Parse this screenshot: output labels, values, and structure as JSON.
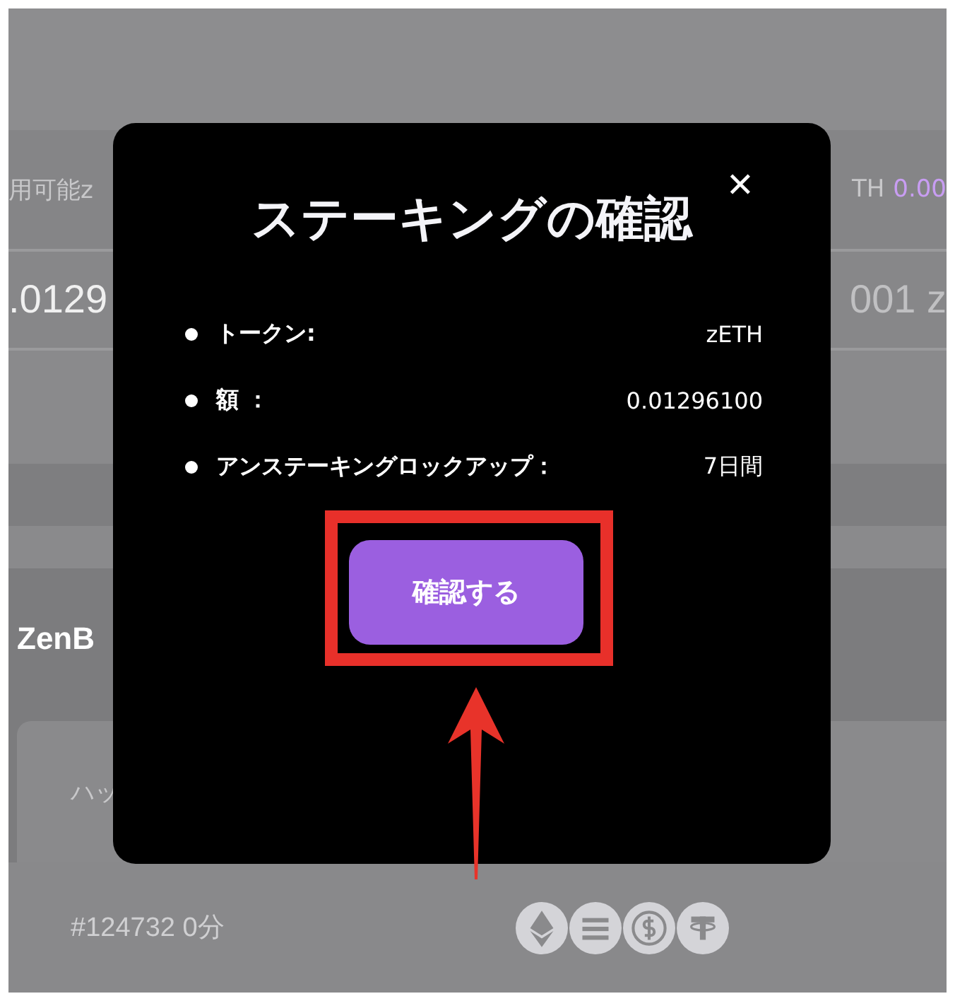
{
  "background": {
    "balance_label": "用可能z",
    "balance_unit": "TH",
    "balance_value": "0.00",
    "amount": ".0129",
    "amount_right": "001 z",
    "section_title": "ZenB",
    "card_label": "ハッ",
    "block": "#124732 0分",
    "coins": [
      {
        "kind": "eth"
      },
      {
        "kind": "sol"
      },
      {
        "kind": "usdc"
      },
      {
        "kind": "usdt"
      }
    ]
  },
  "dialog": {
    "title": "ステーキングの確認",
    "close": "✕",
    "rows": [
      {
        "label": "トークン:",
        "value": "zETH"
      },
      {
        "label": "額 ：",
        "value": "0.01296100"
      },
      {
        "label": "アンステーキングロックアップ：",
        "value": "7日間"
      }
    ],
    "confirm_button": "確認する"
  },
  "annotations": {
    "highlight_frame": true,
    "arrow": true
  }
}
